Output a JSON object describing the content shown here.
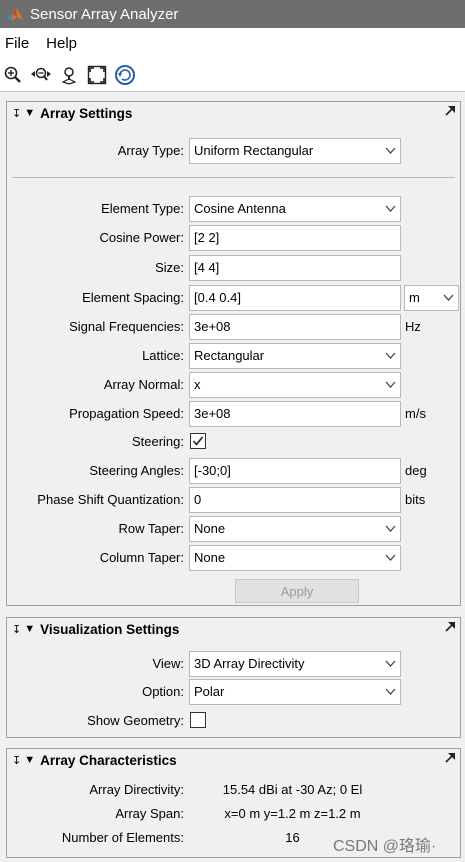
{
  "window": {
    "title": "Sensor Array Analyzer"
  },
  "menu": {
    "items": [
      "File",
      "Help"
    ]
  },
  "toolbar": {
    "icons": [
      "zoom-in-icon",
      "zoom-out-icon",
      "pan-icon",
      "fit-to-view-icon",
      "rotate-icon"
    ]
  },
  "array_settings": {
    "title": "Array Settings",
    "array_type": {
      "label": "Array Type:",
      "value": "Uniform Rectangular"
    },
    "element_type": {
      "label": "Element Type:",
      "value": "Cosine Antenna"
    },
    "cosine_power": {
      "label": "Cosine Power:",
      "value": "[2 2]"
    },
    "size": {
      "label": "Size:",
      "value": "[4 4]"
    },
    "element_spacing": {
      "label": "Element Spacing:",
      "value": "[0.4 0.4]",
      "unit": "m"
    },
    "signal_frequencies": {
      "label": "Signal Frequencies:",
      "value": "3e+08",
      "unit": "Hz"
    },
    "lattice": {
      "label": "Lattice:",
      "value": "Rectangular"
    },
    "array_normal": {
      "label": "Array Normal:",
      "value": "x"
    },
    "propagation_speed": {
      "label": "Propagation Speed:",
      "value": "3e+08",
      "unit": "m/s"
    },
    "steering": {
      "label": "Steering:",
      "checked": true
    },
    "steering_angles": {
      "label": "Steering Angles:",
      "value": "[-30;0]",
      "unit": "deg"
    },
    "phase_shift": {
      "label": "Phase Shift Quantization:",
      "value": "0",
      "unit": "bits"
    },
    "row_taper": {
      "label": "Row Taper:",
      "value": "None"
    },
    "column_taper": {
      "label": "Column Taper:",
      "value": "None"
    },
    "apply_label": "Apply"
  },
  "visualization_settings": {
    "title": "Visualization Settings",
    "view": {
      "label": "View:",
      "value": "3D Array Directivity"
    },
    "option": {
      "label": "Option:",
      "value": "Polar"
    },
    "show_geometry": {
      "label": "Show Geometry:",
      "checked": false
    }
  },
  "array_characteristics": {
    "title": "Array Characteristics",
    "directivity": {
      "label": "Array Directivity:",
      "value": "15.54 dBi at -30 Az; 0 El"
    },
    "span": {
      "label": "Array Span:",
      "value": "x=0 m y=1.2 m z=1.2 m"
    },
    "num_elements": {
      "label": "Number of Elements:",
      "value": "16"
    }
  },
  "watermark": "CSDN @珞瑜·"
}
